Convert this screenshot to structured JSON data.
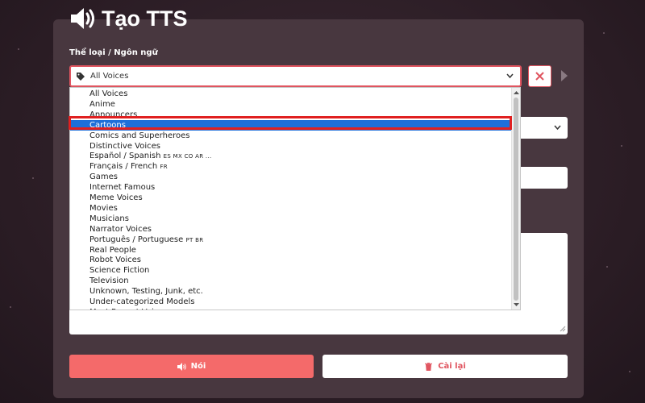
{
  "page": {
    "title": "Tạo TTS"
  },
  "form": {
    "category_label": "Thể loại / Ngôn ngữ",
    "category_selected": "All Voices"
  },
  "dropdown": {
    "options": [
      {
        "label": "All Voices",
        "codes": ""
      },
      {
        "label": "Anime",
        "codes": ""
      },
      {
        "label": "Announcers",
        "codes": ""
      },
      {
        "label": "Cartoons",
        "codes": ""
      },
      {
        "label": "Comics and Superheroes",
        "codes": ""
      },
      {
        "label": "Distinctive Voices",
        "codes": ""
      },
      {
        "label": "Español / Spanish",
        "codes": "ES MX CO AR ..."
      },
      {
        "label": "Français / French",
        "codes": "FR"
      },
      {
        "label": "Games",
        "codes": ""
      },
      {
        "label": "Internet Famous",
        "codes": ""
      },
      {
        "label": "Meme Voices",
        "codes": ""
      },
      {
        "label": "Movies",
        "codes": ""
      },
      {
        "label": "Musicians",
        "codes": ""
      },
      {
        "label": "Narrator Voices",
        "codes": ""
      },
      {
        "label": "Português / Portuguese",
        "codes": "PT BR"
      },
      {
        "label": "Real People",
        "codes": ""
      },
      {
        "label": "Robot Voices",
        "codes": ""
      },
      {
        "label": "Science Fiction",
        "codes": ""
      },
      {
        "label": "Television",
        "codes": ""
      },
      {
        "label": "Unknown, Testing, Junk, etc.",
        "codes": ""
      },
      {
        "label": "Under-categorized Models",
        "codes": ""
      },
      {
        "label": "Most Recent Voices",
        "codes": ""
      }
    ],
    "highlighted": "Cartoons"
  },
  "buttons": {
    "speak_label": "Nói",
    "reset_label": "Cài lại"
  },
  "colors": {
    "accent": "#f46a6a",
    "selection": "#1e6fd9",
    "card": "#48373f",
    "background": "#2a1c24"
  }
}
